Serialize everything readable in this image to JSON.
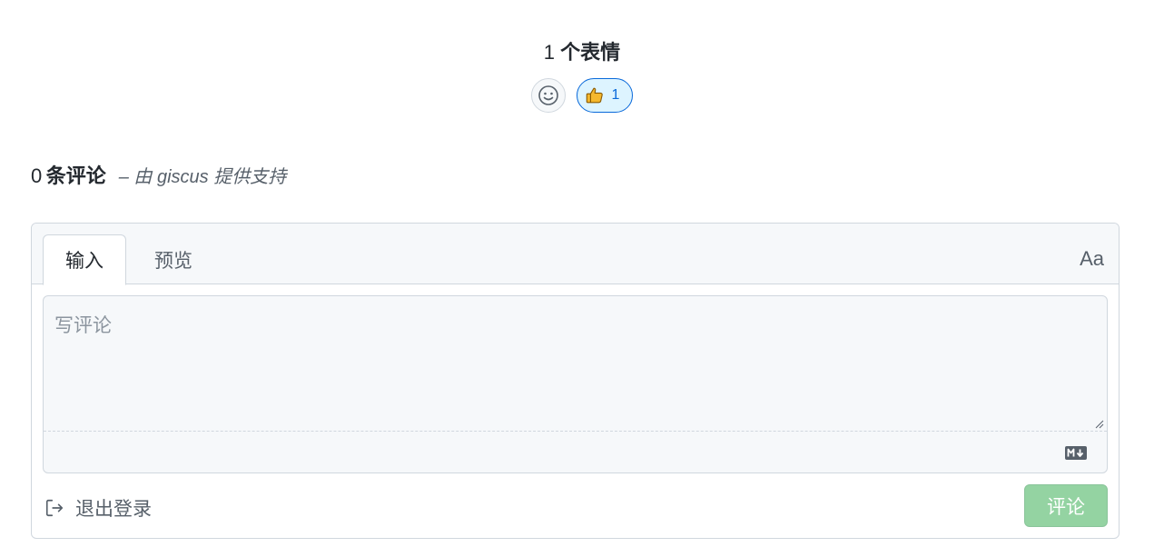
{
  "reactions": {
    "count": "1",
    "label": "个表情",
    "items": [
      {
        "emoji": "thumbs-up-icon",
        "count": "1"
      }
    ]
  },
  "comments": {
    "count": "0",
    "label": "条评论",
    "powered_by": "– 由 giscus 提供支持"
  },
  "editor": {
    "tabs": [
      {
        "label": "输入",
        "active": true
      },
      {
        "label": "预览",
        "active": false
      }
    ],
    "font_toggle": "Aa",
    "placeholder": "写评论",
    "value": ""
  },
  "footer": {
    "signout_label": "退出登录",
    "submit_label": "评论"
  },
  "colors": {
    "accent": "#0969da",
    "reaction_bg": "#ddf4ff",
    "submit_disabled": "#94d3a2"
  }
}
